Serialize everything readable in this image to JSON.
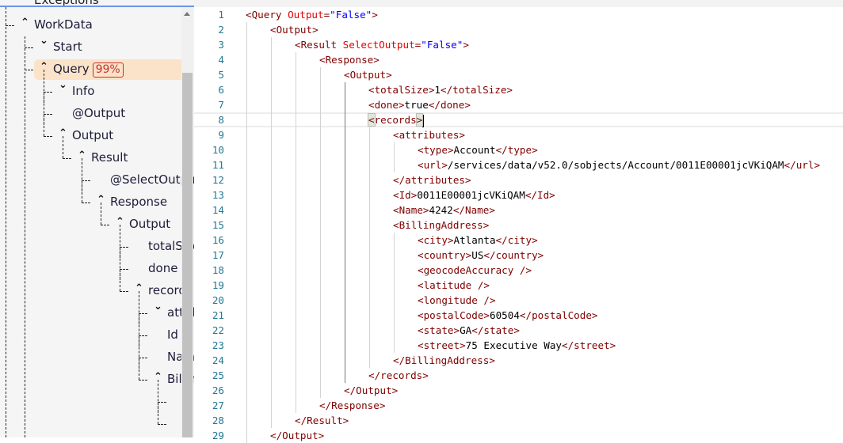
{
  "tree": {
    "partial_top_label": "Exceptions",
    "items": [
      {
        "label": "WorkData",
        "level": 0,
        "chevron": "up"
      },
      {
        "label": "Start",
        "level": 1,
        "chevron": "down"
      },
      {
        "label": "Query",
        "level": 1,
        "chevron": "up",
        "selected": true,
        "badge": "99%"
      },
      {
        "label": "Info",
        "level": 2,
        "chevron": "down"
      },
      {
        "label": "@Output",
        "level": 2,
        "chevron": ""
      },
      {
        "label": "Output",
        "level": 2,
        "chevron": "up"
      },
      {
        "label": "Result",
        "level": 3,
        "chevron": "up"
      },
      {
        "label": "@SelectOutput",
        "level": 4,
        "chevron": ""
      },
      {
        "label": "Response",
        "level": 4,
        "chevron": "up"
      },
      {
        "label": "Output",
        "level": 5,
        "chevron": "up"
      },
      {
        "label": "totalSize",
        "level": 6,
        "chevron": ""
      },
      {
        "label": "done",
        "level": 6,
        "chevron": ""
      },
      {
        "label": "records",
        "level": 6,
        "chevron": "up"
      },
      {
        "label": "attributes",
        "level": 7,
        "chevron": "down"
      },
      {
        "label": "Id",
        "level": 7,
        "chevron": ""
      },
      {
        "label": "Name",
        "level": 7,
        "chevron": ""
      },
      {
        "label": "BillingAddress",
        "level": 7,
        "chevron": "up"
      },
      {
        "label": "",
        "level": 8,
        "chevron": ""
      },
      {
        "label": "",
        "level": 8,
        "chevron": ""
      }
    ],
    "colors": {
      "selected_bg": "#fbe3c9",
      "badge": "#c4302b"
    }
  },
  "editor": {
    "cursor_line": 8,
    "lines": [
      {
        "n": "1",
        "indent": 0,
        "tokens": [
          [
            "tag",
            "<Query "
          ],
          [
            "attr",
            "Output"
          ],
          [
            "tag",
            "="
          ],
          [
            "val",
            "\"False\""
          ],
          [
            "tag",
            ">"
          ]
        ]
      },
      {
        "n": "2",
        "indent": 1,
        "tokens": [
          [
            "tag",
            "<Output>"
          ]
        ]
      },
      {
        "n": "3",
        "indent": 2,
        "tokens": [
          [
            "tag",
            "<Result "
          ],
          [
            "attr",
            "SelectOutput"
          ],
          [
            "tag",
            "="
          ],
          [
            "val",
            "\"False\""
          ],
          [
            "tag",
            ">"
          ]
        ]
      },
      {
        "n": "4",
        "indent": 3,
        "tokens": [
          [
            "tag",
            "<Response>"
          ]
        ]
      },
      {
        "n": "5",
        "indent": 4,
        "tokens": [
          [
            "tag",
            "<Output>"
          ]
        ]
      },
      {
        "n": "6",
        "indent": 5,
        "tokens": [
          [
            "tag",
            "<totalSize>"
          ],
          [
            "text",
            "1"
          ],
          [
            "tag",
            "</totalSize>"
          ]
        ]
      },
      {
        "n": "7",
        "indent": 5,
        "tokens": [
          [
            "tag",
            "<done>"
          ],
          [
            "text",
            "true"
          ],
          [
            "tag",
            "</done>"
          ]
        ]
      },
      {
        "n": "8",
        "indent": 5,
        "tokens": [
          [
            "brtag",
            "<"
          ],
          [
            "tag",
            "records"
          ],
          [
            "brtag",
            ">"
          ]
        ]
      },
      {
        "n": "9",
        "indent": 6,
        "tokens": [
          [
            "tag",
            "<attributes>"
          ]
        ]
      },
      {
        "n": "10",
        "indent": 7,
        "tokens": [
          [
            "tag",
            "<type>"
          ],
          [
            "text",
            "Account"
          ],
          [
            "tag",
            "</type>"
          ]
        ]
      },
      {
        "n": "11",
        "indent": 7,
        "tokens": [
          [
            "tag",
            "<url>"
          ],
          [
            "text",
            "/services/data/v52.0/sobjects/Account/0011E00001jcVKiQAM"
          ],
          [
            "tag",
            "</url>"
          ]
        ]
      },
      {
        "n": "12",
        "indent": 6,
        "tokens": [
          [
            "tag",
            "</attributes>"
          ]
        ]
      },
      {
        "n": "13",
        "indent": 6,
        "tokens": [
          [
            "tag",
            "<Id>"
          ],
          [
            "text",
            "0011E00001jcVKiQAM"
          ],
          [
            "tag",
            "</Id>"
          ]
        ]
      },
      {
        "n": "14",
        "indent": 6,
        "tokens": [
          [
            "tag",
            "<Name>"
          ],
          [
            "text",
            "4242"
          ],
          [
            "tag",
            "</Name>"
          ]
        ]
      },
      {
        "n": "15",
        "indent": 6,
        "tokens": [
          [
            "tag",
            "<BillingAddress>"
          ]
        ]
      },
      {
        "n": "16",
        "indent": 7,
        "tokens": [
          [
            "tag",
            "<city>"
          ],
          [
            "text",
            "Atlanta"
          ],
          [
            "tag",
            "</city>"
          ]
        ]
      },
      {
        "n": "17",
        "indent": 7,
        "tokens": [
          [
            "tag",
            "<country>"
          ],
          [
            "text",
            "US"
          ],
          [
            "tag",
            "</country>"
          ]
        ]
      },
      {
        "n": "18",
        "indent": 7,
        "tokens": [
          [
            "tag",
            "<geocodeAccuracy />"
          ]
        ]
      },
      {
        "n": "19",
        "indent": 7,
        "tokens": [
          [
            "tag",
            "<latitude />"
          ]
        ]
      },
      {
        "n": "20",
        "indent": 7,
        "tokens": [
          [
            "tag",
            "<longitude />"
          ]
        ]
      },
      {
        "n": "21",
        "indent": 7,
        "tokens": [
          [
            "tag",
            "<postalCode>"
          ],
          [
            "text",
            "60504"
          ],
          [
            "tag",
            "</postalCode>"
          ]
        ]
      },
      {
        "n": "22",
        "indent": 7,
        "tokens": [
          [
            "tag",
            "<state>"
          ],
          [
            "text",
            "GA"
          ],
          [
            "tag",
            "</state>"
          ]
        ]
      },
      {
        "n": "23",
        "indent": 7,
        "tokens": [
          [
            "tag",
            "<street>"
          ],
          [
            "text",
            "75 Executive Way"
          ],
          [
            "tag",
            "</street>"
          ]
        ]
      },
      {
        "n": "24",
        "indent": 6,
        "tokens": [
          [
            "tag",
            "</BillingAddress>"
          ]
        ]
      },
      {
        "n": "25",
        "indent": 5,
        "tokens": [
          [
            "tag",
            "</records>"
          ]
        ]
      },
      {
        "n": "26",
        "indent": 4,
        "tokens": [
          [
            "tag",
            "</Output>"
          ]
        ]
      },
      {
        "n": "27",
        "indent": 3,
        "tokens": [
          [
            "tag",
            "</Response>"
          ]
        ]
      },
      {
        "n": "28",
        "indent": 2,
        "tokens": [
          [
            "tag",
            "</Result>"
          ]
        ]
      },
      {
        "n": "29",
        "indent": 1,
        "tokens": [
          [
            "tag",
            "</Output>"
          ]
        ]
      }
    ],
    "colors": {
      "tag": "#800000",
      "attribute": "#e50000",
      "value": "#0000ff",
      "line_number": "#237893"
    }
  }
}
